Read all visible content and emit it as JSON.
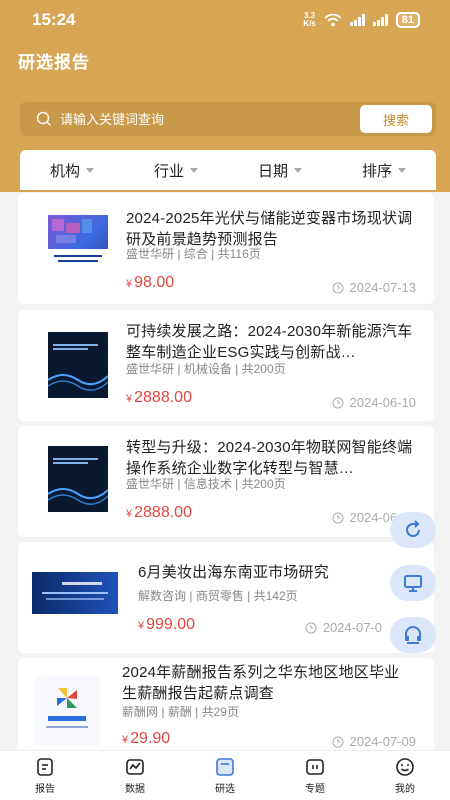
{
  "status_bar": {
    "time": "15:24",
    "net_speed_top": "3.3",
    "net_speed_bottom": "K/s",
    "battery": "81"
  },
  "header": {
    "title": "研选报告"
  },
  "search": {
    "placeholder": "请输入关键词查询",
    "button": "搜索"
  },
  "filters": [
    "机构",
    "行业",
    "日期",
    "排序"
  ],
  "reports": [
    {
      "title": "2024-2025年光伏与储能逆变器市场现状调研及前景趋势预测报告",
      "source": "盛世华研",
      "category": "综合",
      "pages": "共116页",
      "currency": "¥",
      "price": "98.00",
      "date": "2024-07-13"
    },
    {
      "title": "可持续发展之路：2024-2030年新能源汽车整车制造企业ESG实践与创新战…",
      "source": "盛世华研",
      "category": "机械设备",
      "pages": "共200页",
      "currency": "¥",
      "price": "2888.00",
      "date": "2024-06-10"
    },
    {
      "title": "转型与升级：2024-2030年物联网智能终端操作系统企业数字化转型与智慧…",
      "source": "盛世华研",
      "category": "信息技术",
      "pages": "共200页",
      "currency": "¥",
      "price": "2888.00",
      "date": "2024-06-10"
    },
    {
      "title": "6月美妆出海东南亚市场研究",
      "source": "解数咨询",
      "category": "商贸零售",
      "pages": "共142页",
      "currency": "¥",
      "price": "999.00",
      "date": "2024-07-0"
    },
    {
      "title": "2024年薪酬报告系列之华东地区地区毕业生薪酬报告起薪点调查",
      "source": "薪酬网",
      "category": "薪酬",
      "pages": "共29页",
      "currency": "¥",
      "price": "29.90",
      "date": "2024-07-09"
    }
  ],
  "bottom_nav": [
    {
      "label": "报告",
      "icon": "report-icon"
    },
    {
      "label": "数据",
      "icon": "data-icon"
    },
    {
      "label": "研选",
      "icon": "research-icon"
    },
    {
      "label": "专题",
      "icon": "topic-icon"
    },
    {
      "label": "我的",
      "icon": "profile-icon"
    }
  ],
  "colors": {
    "accent": "#d6a655",
    "price": "#e0463f",
    "float_button": "#dbe7f8"
  }
}
